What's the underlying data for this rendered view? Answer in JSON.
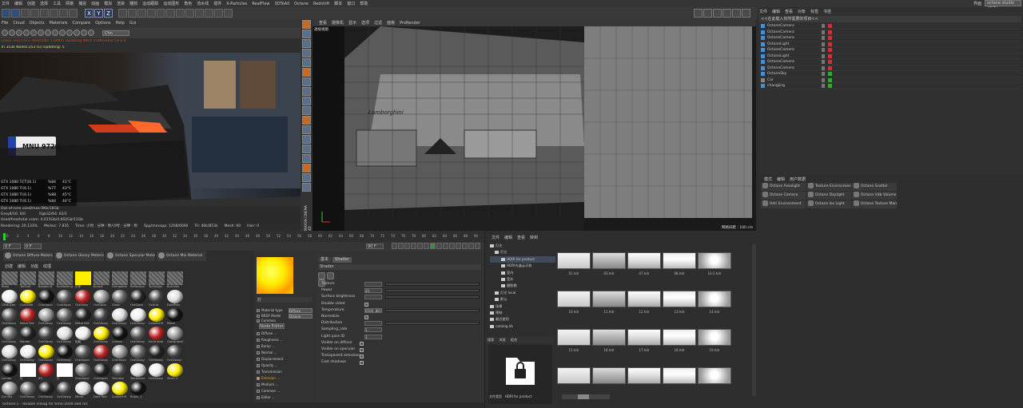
{
  "menubar": {
    "items": [
      "文件",
      "编辑",
      "创建",
      "选择",
      "工具",
      "网格",
      "捕捉",
      "动画",
      "模拟",
      "渲染",
      "雕刻",
      "运动跟踪",
      "运动图形",
      "角色",
      "流水线",
      "插件",
      "X-Particles",
      "RealFlow",
      "3DToAll",
      "Octane",
      "Redshift",
      "脚本",
      "窗口",
      "帮助"
    ],
    "right_label": "界面",
    "layout_value": "octane studio (用户)"
  },
  "axis_buttons": [
    "X",
    "Y",
    "Z"
  ],
  "octane_viewer": {
    "menu": [
      "File",
      "Cloud",
      "Objects",
      "Materials",
      "Compare",
      "Options",
      "Help",
      "Gui"
    ],
    "mode_value": "Chn",
    "status_line1": "Check Tess.Chrs: MeshObn 1.6Mtrn Updating Mesh 41MovabIe:59 0.0",
    "status_line2": "Tri 353k Nodes:253 (G) Updating: 5",
    "plate_text": "MNU 9720",
    "gpus": [
      {
        "name": "GTX 1080 Ti[T](6.1)",
        "pct": "%84",
        "temp": "41°C"
      },
      {
        "name": "GTX 1080 Ti(6.1)",
        "pct": "%77",
        "temp": "43°C"
      },
      {
        "name": "GTX 1080 Ti(6.1)",
        "pct": "%88",
        "temp": "45°C"
      },
      {
        "name": "GTX 1080 Ti(6.1)",
        "pct": "%84",
        "temp": "44°C"
      }
    ],
    "info_lines": [
      "Out-of-core used/max:0Kb/16Gb",
      "Grey8/16: 0/0            Rgb32/64: 83/1",
      "Used/free/total vram: 4.015Gb/4.602Gb/11Gb"
    ],
    "render_stats": [
      "Rendering: 20.133%",
      "Ms/sec: 7.835",
      "Time: 小时 : 分钟 : 秒/小时 : 分钟 : 秒",
      "Spp/maxspp: 1208/6000",
      "Tri: 40k/853k",
      "Mesh: 60",
      "Hair: 0"
    ]
  },
  "viewport": {
    "menu": [
      "查看",
      "摄像机",
      "显示",
      "选项",
      "过滤",
      "面板",
      "ProRender"
    ],
    "label": "透视视图",
    "car_text": "Lamborghini",
    "grid_spacing": "网格间距 : 100 cm",
    "side_logo": "MAXON CINEMA 4D"
  },
  "objects": {
    "menu": [
      "文件",
      "编辑",
      "查看",
      "对象",
      "标签",
      "书签"
    ],
    "path": "<<在此载入你所需要的项目<<",
    "items": [
      "OctaneCamera",
      "OctaneCamera",
      "OctaneCamera",
      "OctaneLight",
      "OctaneCamera",
      "OctaneLight",
      "OctaneCamera",
      "OctaneCamera",
      "OctaneSky",
      "Car",
      "changjing"
    ]
  },
  "content": {
    "menu": [
      "模式",
      "编辑",
      "用户数据"
    ],
    "items": [
      [
        "Octane Arealight",
        "Texture Environment",
        "Octane Scatter"
      ],
      [
        "Octane Camera",
        "Octane Daylight",
        "Octane Vdb Volume"
      ],
      [
        "Hdri Environment",
        "Octane Ies Light",
        "Octane Texture Manager"
      ]
    ]
  },
  "timeline": {
    "ticks": [
      "0",
      "2",
      "4",
      "6",
      "8",
      "10",
      "12",
      "14",
      "16",
      "18",
      "20",
      "22",
      "24",
      "26",
      "28",
      "30",
      "32",
      "34",
      "36",
      "38",
      "40",
      "42",
      "44",
      "46",
      "48",
      "50",
      "52",
      "54",
      "56",
      "58",
      "60",
      "62",
      "64",
      "66",
      "68",
      "70",
      "72",
      "74",
      "76",
      "78",
      "80",
      "82",
      "84",
      "86",
      "88",
      "90"
    ],
    "current_frame": "0 F",
    "start": "0 F",
    "end": "90 F",
    "end2": "90 F"
  },
  "material_browser": {
    "top_tabs": [
      "创建",
      "编辑",
      "功能",
      "纹理"
    ],
    "presets": [
      "Octane Diffuse Material",
      "Octane Glossy Material",
      "Octane Specular Material",
      "Octane Mix Material"
    ],
    "sub_tabs": [
      "创建",
      "编辑",
      "功能",
      "纹理"
    ],
    "rows": [
      [
        "Road",
        "TexTure",
        "Beaded B",
        "Scaffolding",
        "灯条",
        "BunsD",
        "Orangelite",
        "Reflection",
        "TechAlign",
        "BurnVee"
      ],
      [
        "OPlauyter",
        "Concrete",
        "Checkpon",
        "Checkpon",
        "OctGloss",
        "OctGloss",
        "Gloss",
        "OctGloss",
        "Grdiuit",
        "DarkPalu"
      ],
      [
        "OctGlossy",
        "Metal Dirt",
        "OctGlossy",
        "OctGlossy",
        "Metal Dirt",
        "OctGlossy",
        "OctGlossy",
        "OctGlossy",
        "Colored M",
        "Metal"
      ],
      [
        "OctGlossy",
        "Marble",
        "OctGlossy",
        "OctGlossy",
        "轮胎",
        "OctGlossy",
        "Carbon",
        "OctGlossy",
        "Drrid Inter",
        "Galvanized"
      ],
      [
        "OctGlossy",
        "OctGlossy",
        "OctGlossy",
        "OctGlossy",
        "Checkpon",
        "OctGlossy",
        "Checkpon",
        "OctGlossy",
        "OctGlossy",
        "OctGlossy"
      ],
      [
        "Lambo",
        "灯",
        "X3",
        "灯",
        "Checkpon",
        "Checkpon",
        "Tarmasa",
        "Tetrameer",
        "OctGlossy",
        "Silver 2"
      ],
      [
        "Car Mix",
        "OctGlossy",
        "OctGlossy",
        "OctGlossy",
        "Mirror",
        "Dark Red",
        "Colored M",
        "Rubin_1",
        "",
        ""
      ]
    ]
  },
  "material_editor": {
    "name": "灯",
    "props": [
      "Material type",
      "BRDF Model",
      "Common"
    ],
    "type_value": "Diffuse",
    "brdf_value": "Octane",
    "node_editor": "Node Editor",
    "channels": [
      "Diffuse ...",
      "Roughness ...",
      "Bump ...",
      "Normal ...",
      "Displacement",
      "Opacity ...",
      "Transmission",
      "Emission ...",
      "Medium ...",
      "Common ...",
      "Editor ..."
    ]
  },
  "attributes": {
    "tabs": [
      "基本",
      "Shader"
    ],
    "section": "Shader",
    "rows": [
      {
        "label": "Texture",
        "value": ""
      },
      {
        "label": "Power",
        "value": "20."
      },
      {
        "label": "Surface brightness",
        "value": ""
      },
      {
        "label": "Double sided",
        "value": ""
      },
      {
        "label": "Temperature",
        "value": "6500. 88 K"
      },
      {
        "label": "Normalize",
        "value": ""
      },
      {
        "label": "Distribution",
        "value": ""
      },
      {
        "label": "Sampling_rate",
        "value": "1."
      },
      {
        "label": "Light pass ID",
        "value": "1"
      },
      {
        "label": "Visible on diffuse",
        "value": ""
      },
      {
        "label": "Visible on specular",
        "value": ""
      },
      {
        "label": "Transparent emission",
        "value": ""
      },
      {
        "label": "Cast shadows",
        "value": ""
      }
    ]
  },
  "asset_browser": {
    "menu": [
      "文件",
      "编辑",
      "查看",
      "转到"
    ],
    "tree": [
      "灯光",
      "灯光",
      "HDRI for product",
      "HDRI光盒云天和",
      "室内",
      "室外",
      "摄影棚",
      "灯光 local",
      "默认",
      "场景",
      "预制",
      "最近使用",
      "catalog.lib"
    ],
    "bottom_tabs": [
      "搜索",
      "浏览",
      "组合"
    ],
    "preview_folder": "文件类型",
    "preview_name": "HDRI for product",
    "hdr_labels": [
      "01.hdr",
      "03.hdr",
      "07.hdr",
      "08.hdr",
      "10-2.hdr",
      "10.hdr",
      "11.hdr",
      "12.hdr",
      "13.hdr",
      "14.hdr",
      "15.hdr",
      "16.hdr",
      "17.hdr",
      "18.hdr",
      "19.hdr",
      "",
      "",
      "",
      "",
      ""
    ]
  },
  "status_bar": "Octane:1 - disable indiag for time:1609.484 ms"
}
